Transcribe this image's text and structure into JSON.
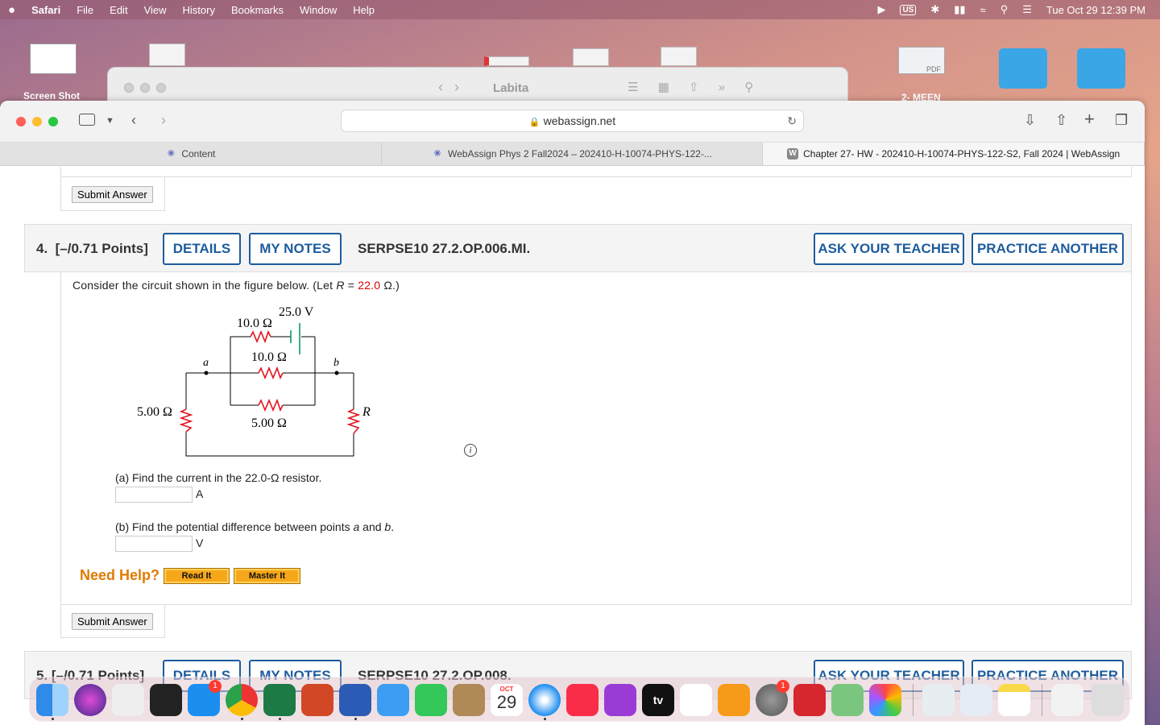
{
  "menubar": {
    "app": "Safari",
    "items": [
      "File",
      "Edit",
      "View",
      "History",
      "Bookmarks",
      "Window",
      "Help"
    ],
    "keyboard": "US",
    "datetime": "Tue Oct 29  12:39 PM"
  },
  "desktop": {
    "screenshot_label": "Screen Shot",
    "folder_label": "2- MEEN",
    "pdf_label": "PDF"
  },
  "background_window": {
    "title": "Labita"
  },
  "browser": {
    "url": "webassign.net",
    "tabs": [
      {
        "label": "Content",
        "active": false
      },
      {
        "label": "WebAssign Phys 2 Fall2024 – 202410-H-10074-PHYS-122-...",
        "active": false
      },
      {
        "label": "Chapter 27- HW - 202410-H-10074-PHYS-122-S2, Fall 2024 | WebAssign",
        "active": true,
        "icon": "W"
      }
    ]
  },
  "page": {
    "submit_label": "Submit Answer",
    "question4": {
      "number": "4.",
      "points": "[–/0.71 Points]",
      "details": "DETAILS",
      "my_notes": "MY NOTES",
      "code": "SERPSE10 27.2.OP.006.MI.",
      "ask_teacher": "ASK YOUR TEACHER",
      "practice_another": "PRACTICE ANOTHER",
      "prompt_pre": "Consider the circuit shown in the figure below. (Let ",
      "prompt_var": "R",
      "prompt_eq": " = ",
      "prompt_value": "22.0",
      "prompt_post": " Ω.)",
      "circuit": {
        "battery": "25.0 V",
        "r_top": "10.0 Ω",
        "r_mid": "10.0 Ω",
        "r_bottom": "5.00 Ω",
        "r_left": "5.00 Ω",
        "r_right": "R",
        "node_a": "a",
        "node_b": "b"
      },
      "part_a": "(a) Find the current in the 22.0-Ω resistor.",
      "unit_a": "A",
      "part_b_pre": "(b) Find the potential difference between points ",
      "part_b_a": "a",
      "part_b_and": " and ",
      "part_b_b": "b",
      "part_b_end": ".",
      "unit_b": "V",
      "need_help": "Need Help?",
      "read_it": "Read It",
      "master_it": "Master It",
      "info": "i"
    },
    "question5": {
      "label": "5.  [–/0.71 Points]",
      "details": "DETAILS",
      "my_notes": "MY NOTES",
      "code": "SERPSE10 27.2.OP.008.",
      "ask_teacher": "ASK YOUR TEACHER",
      "practice_another": "PRACTICE ANOTHER"
    }
  },
  "dock": {
    "calendar_month": "OCT",
    "calendar_day": "29",
    "appstore_badge": "1",
    "settings_badge": "1",
    "tv_label": "tv"
  }
}
